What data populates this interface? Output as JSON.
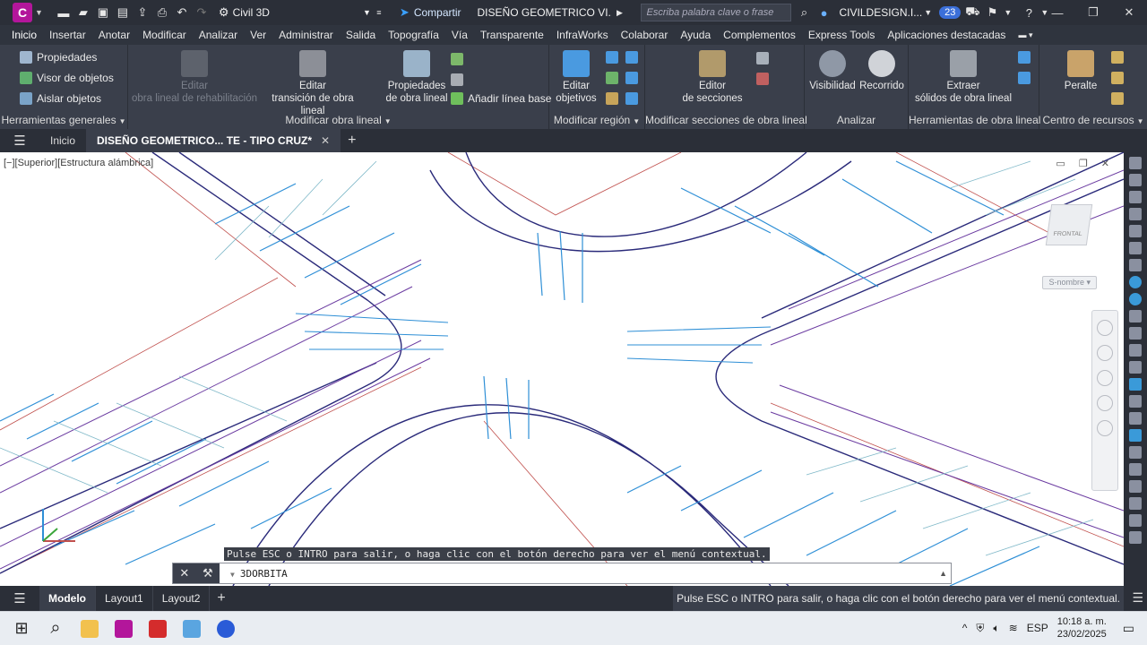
{
  "titlebar": {
    "app_badge": "C",
    "workspace": "Civil 3D",
    "share": "Compartir",
    "document_title": "DISEÑO GEOMETRICO VI...",
    "search_placeholder": "Escriba palabra clave o frase",
    "user": "CIVILDESIGN.I...",
    "notifications": "23"
  },
  "menu": [
    "Inicio",
    "Insertar",
    "Anotar",
    "Modificar",
    "Analizar",
    "Ver",
    "Administrar",
    "Salida",
    "Topografía",
    "Vía",
    "Transparente",
    "InfraWorks",
    "Colaborar",
    "Ayuda",
    "Complementos",
    "Express Tools",
    "Aplicaciones destacadas"
  ],
  "ribbon": {
    "general": {
      "items": [
        "Propiedades",
        "Visor de objetos",
        "Aislar objetos"
      ],
      "title": "Herramientas generales"
    },
    "modify_corridor": {
      "edit_rehab_line1": "Editar",
      "edit_rehab_line2": "obra lineal de rehabilitación",
      "edit_transition_line1": "Editar",
      "edit_transition_line2": "transición de obra lineal",
      "props_line1": "Propiedades",
      "props_line2": "de obra lineal",
      "add_baseline": "Añadir línea base",
      "title": "Modificar obra lineal"
    },
    "modify_region": {
      "edit_targets_line1": "Editar",
      "edit_targets_line2": "objetivos",
      "title": "Modificar región"
    },
    "modify_sections": {
      "editor_line1": "Editor",
      "editor_line2": "de secciones",
      "title": "Modificar secciones de obra lineal"
    },
    "analyze": {
      "visibility": "Visibilidad",
      "walkthrough": "Recorrido",
      "title": "Analizar"
    },
    "corridor_tools": {
      "extract_line1": "Extraer",
      "extract_line2": "sólidos de obra lineal",
      "title": "Herramientas de obra lineal"
    },
    "resources": {
      "superelevation": "Peralte",
      "title": "Centro de recursos"
    }
  },
  "doctabs": {
    "home": "Inicio",
    "current": "DISEÑO GEOMETRICO... TE - TIPO CRUZ*"
  },
  "viewport": {
    "label": "[−][Superior][Estructura alámbrica]",
    "viewcube_face": "FRONTAL",
    "ucs_name": "S-nombre",
    "prompt_message": "Pulse ESC o INTRO para salir, o haga clic con el botón derecho para ver el menú contextual.",
    "command": "3DORBITA"
  },
  "layouts": [
    "Modelo",
    "Layout1",
    "Layout2"
  ],
  "status_message": "Pulse ESC o INTRO para salir, o haga clic con el botón derecho para ver el menú contextual.",
  "tray": {
    "language": "ESP",
    "time": "10:18 a. m.",
    "date": "23/02/2025"
  }
}
